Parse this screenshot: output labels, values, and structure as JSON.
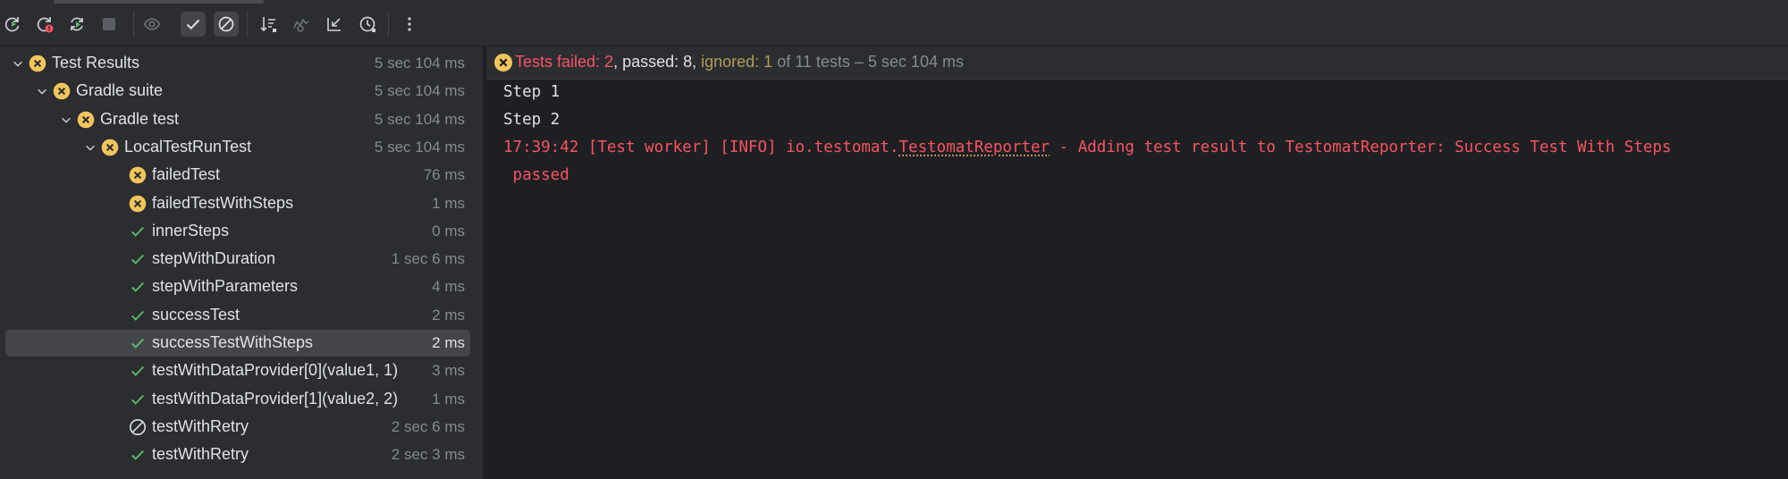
{
  "toolbar": {
    "buttons": [
      {
        "name": "rerun-icon"
      },
      {
        "name": "rerun-failed-icon"
      },
      {
        "name": "rerun-automatically-icon"
      },
      {
        "name": "stop-icon"
      },
      {
        "name": "show-ignored-icon"
      },
      {
        "name": "show-passed-icon"
      },
      {
        "name": "show-ignored-filter-icon"
      },
      {
        "name": "sort-icon"
      },
      {
        "name": "compare-icon"
      },
      {
        "name": "collapse-icon"
      },
      {
        "name": "history-icon"
      },
      {
        "name": "more-icon"
      }
    ]
  },
  "tree": {
    "rows": [
      {
        "label": "Test Results",
        "time": "5 sec 104 ms",
        "status": "failed"
      },
      {
        "label": "Gradle suite",
        "time": "5 sec 104 ms",
        "status": "failed"
      },
      {
        "label": "Gradle test",
        "time": "5 sec 104 ms",
        "status": "failed"
      },
      {
        "label": "LocalTestRunTest",
        "time": "5 sec 104 ms",
        "status": "failed"
      },
      {
        "label": "failedTest",
        "time": "76 ms",
        "status": "failed"
      },
      {
        "label": "failedTestWithSteps",
        "time": "1 ms",
        "status": "failed"
      },
      {
        "label": "innerSteps",
        "time": "0 ms",
        "status": "passed"
      },
      {
        "label": "stepWithDuration",
        "time": "1 sec 6 ms",
        "status": "passed"
      },
      {
        "label": "stepWithParameters",
        "time": "4 ms",
        "status": "passed"
      },
      {
        "label": "successTest",
        "time": "2 ms",
        "status": "passed"
      },
      {
        "label": "successTestWithSteps",
        "time": "2 ms",
        "status": "passed"
      },
      {
        "label": "testWithDataProvider[0](value1, 1)",
        "time": "3 ms",
        "status": "passed"
      },
      {
        "label": "testWithDataProvider[1](value2, 2)",
        "time": "1 ms",
        "status": "passed"
      },
      {
        "label": "testWithRetry",
        "time": "2 sec 6 ms",
        "status": "ignored"
      },
      {
        "label": "testWithRetry",
        "time": "2 sec 3 ms",
        "status": "passed"
      }
    ]
  },
  "summary": {
    "failed": "Tests failed: 2",
    "passed": ", passed: 8, ",
    "ignored": "ignored: 1",
    "rest": " of 11 tests – 5 sec 104 ms"
  },
  "console": {
    "line1": "Step 1",
    "line2": "Step 2",
    "line3_pre": "17:39:42 [Test worker] [INFO] io.testomat.",
    "line3_link": "TestomatReporter",
    "line3_post": " - Adding test result to TestomatReporter: Success Test With Steps",
    "line4": " passed"
  },
  "colors": {
    "failed": "#f75464",
    "passed": "#5fb865",
    "warning": "#f2c55c",
    "ignored": "#b09d58"
  }
}
